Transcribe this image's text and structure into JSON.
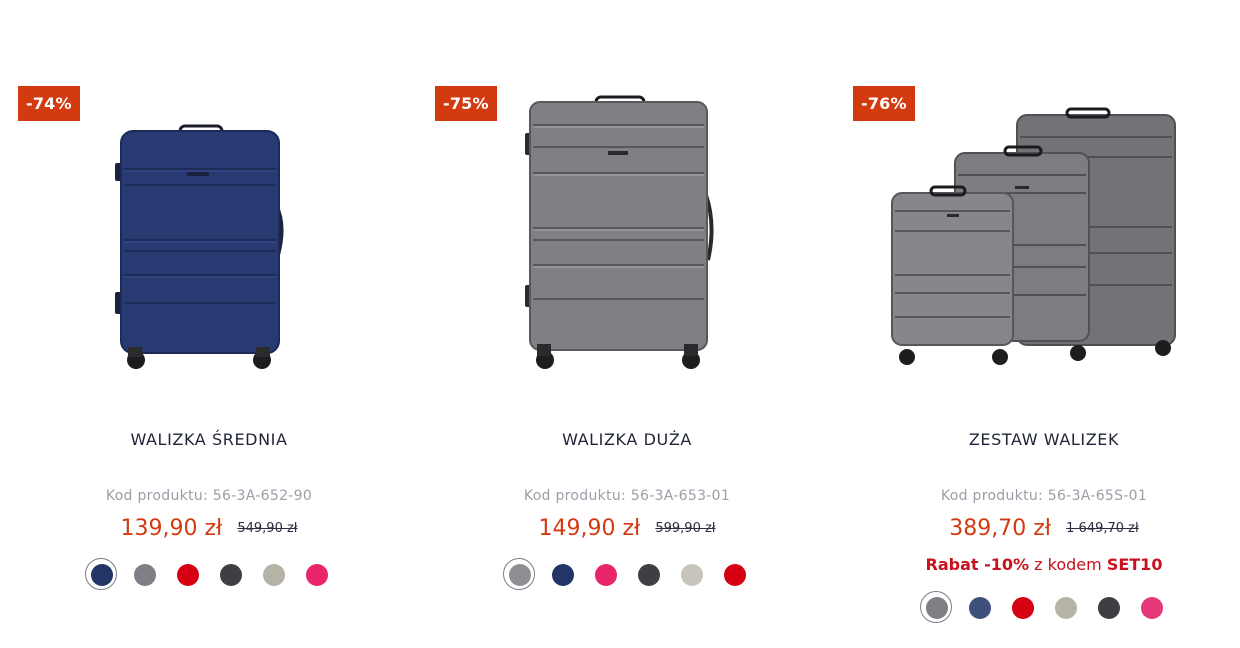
{
  "products": [
    {
      "badge": "-74%",
      "name": "WALIZKA ŚREDNIA",
      "code": "Kod produktu: 56-3A-652-90",
      "price": "139,90 zł",
      "old_price": "549,90 zł",
      "image_icon": "navy-suitcase-image",
      "swatches": [
        "#233566",
        "#7d7f84",
        "#d60013",
        "#3d3f42",
        "#b5b2a6",
        "#e8246a"
      ]
    },
    {
      "badge": "-75%",
      "name": "WALIZKA DUŻA",
      "code": "Kod produktu: 56-3A-653-01",
      "price": "149,90 zł",
      "old_price": "599,90 zł",
      "image_icon": "grey-suitcase-image",
      "swatches": [
        "#8d8f93",
        "#233566",
        "#e8246a",
        "#3d3f42",
        "#c9c5bb",
        "#d60013"
      ]
    },
    {
      "badge": "-76%",
      "name": "ZESTAW WALIZEK",
      "code": "Kod produktu: 56-3A-65S-01",
      "price": "389,70 zł",
      "old_price": "1 649,70 zł",
      "promo": {
        "prefix": "Rabat -10%",
        "middle": " z kodem ",
        "code": "SET10"
      },
      "image_icon": "grey-suitcase-set-image",
      "swatches": [
        "#7d7f84",
        "#3f4f7c",
        "#d60013",
        "#b5b2a6",
        "#3d3f42",
        "#e6397a"
      ]
    }
  ],
  "colors": {
    "accent": "#d23a10",
    "promo": "#c8121f"
  }
}
